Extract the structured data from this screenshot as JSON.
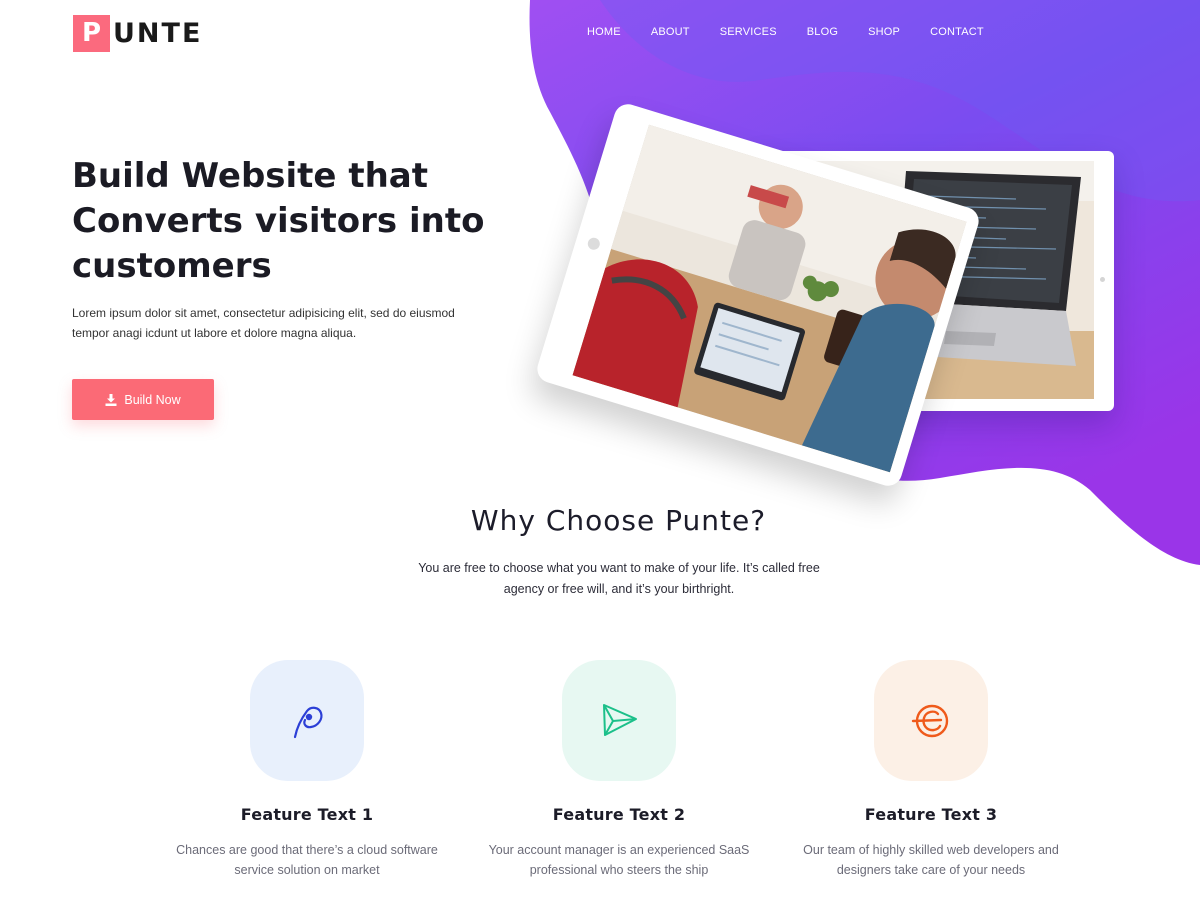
{
  "brand": {
    "logo_letter": "P",
    "logo_rest": "UNTE"
  },
  "nav": {
    "items": [
      "HOME",
      "ABOUT",
      "SERVICES",
      "BLOG",
      "SHOP",
      "CONTACT"
    ]
  },
  "hero": {
    "title": "Build Website that Converts visitors into customers",
    "description": "Lorem ipsum dolor sit amet, consectetur adipisicing elit, sed do eiusmod tempor anagi icdunt ut labore et dolore magna aliqua.",
    "button_label": "Build Now"
  },
  "why": {
    "title": "Why Choose Punte?",
    "description": "You are free to choose what you want to make of your life. It’s called free agency or free will, and it’s your birthright."
  },
  "features": [
    {
      "title": "Feature Text 1",
      "description": "Chances are good that there’s a cloud software service solution on market",
      "icon": "target-pin-icon",
      "color": "#2c3fd6"
    },
    {
      "title": "Feature Text 2",
      "description": "Your account manager is an experienced SaaS professional who steers the ship",
      "icon": "paper-plane-icon",
      "color": "#1cc08a"
    },
    {
      "title": "Feature Text 3",
      "description": "Our team of highly skilled web developers and designers take care of your needs",
      "icon": "orbit-e-icon",
      "color": "#ef5a1b"
    }
  ],
  "colors": {
    "accent": "#fb6a76",
    "gradient_start": "#6f5bf2",
    "gradient_end": "#9a35e8"
  }
}
